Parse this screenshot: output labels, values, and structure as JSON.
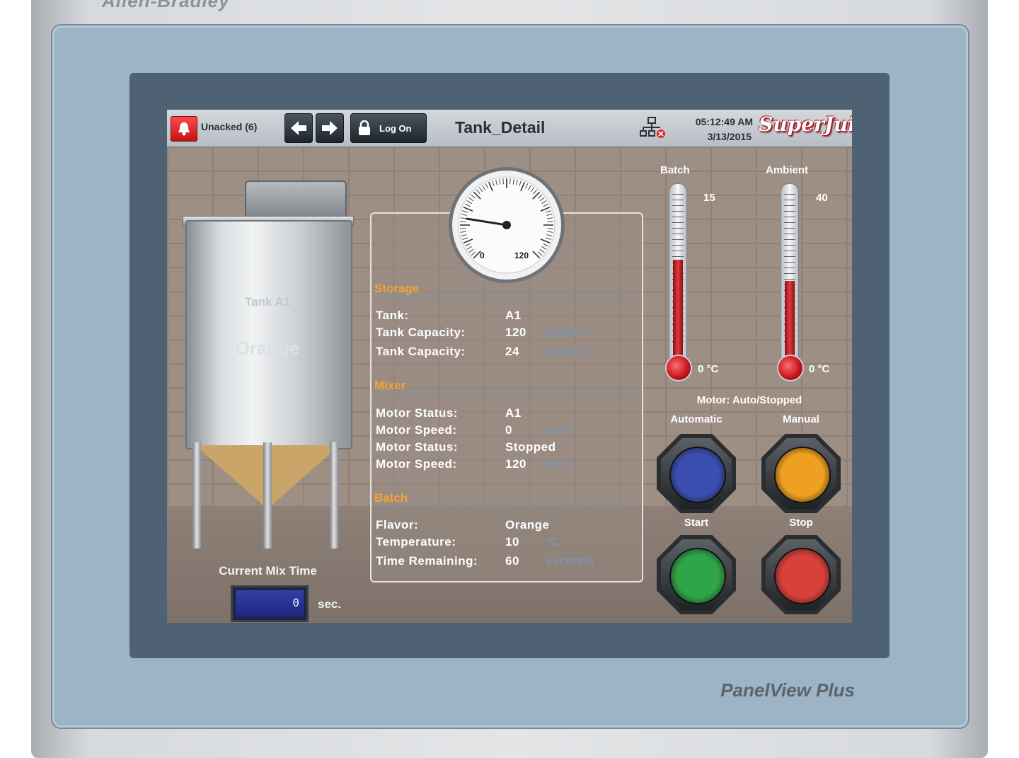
{
  "device": {
    "brand": "Allen-Bradley",
    "model": "PanelView Plus"
  },
  "header": {
    "alarm_label": "Unacked (6)",
    "logon_label": "Log On",
    "screen_title": "Tank_Detail",
    "time": "05:12:49 AM",
    "date": "3/13/2015",
    "logo_text": "SuperJuice"
  },
  "tank": {
    "name": "Tank A1",
    "flavor": "Orange",
    "mix_time_label": "Current Mix Time",
    "mix_time_value": "0",
    "mix_time_unit": "sec."
  },
  "gauge": {
    "min_label": "0",
    "max_label": "120",
    "value": 24
  },
  "storage": {
    "heading": "Storage",
    "rows": [
      {
        "label": "Tank:",
        "value": "A1",
        "unit": ""
      },
      {
        "label": "Tank Capacity:",
        "value": "120",
        "unit": "gallons"
      },
      {
        "label": "Tank Capacity:",
        "value": "24",
        "unit": "gallons"
      }
    ]
  },
  "mixer": {
    "heading": "Mixer",
    "rows": [
      {
        "label": "Motor Status:",
        "value": "A1",
        "unit": ""
      },
      {
        "label": "Motor Speed:",
        "value": "0",
        "unit": "rpm"
      },
      {
        "label": "Motor Status:",
        "value": "Stopped",
        "unit": ""
      },
      {
        "label": "Motor Speed:",
        "value": "120",
        "unit": "rpm"
      }
    ]
  },
  "batch": {
    "heading": "Batch",
    "rows": [
      {
        "label": "Flavor:",
        "value": "Orange",
        "unit": ""
      },
      {
        "label": "Temperature:",
        "value": "10",
        "unit": "°C"
      },
      {
        "label": "Time Remaining:",
        "value": "60",
        "unit": "seconds"
      }
    ]
  },
  "thermometers": {
    "batch": {
      "label": "Batch",
      "max": "15",
      "min": "0 °C",
      "fill_fraction": 0.62
    },
    "ambient": {
      "label": "Ambient",
      "max": "40",
      "min": "0 °C",
      "fill_fraction": 0.5
    }
  },
  "controls": {
    "motor_status": "Motor: Auto/Stopped",
    "automatic_label": "Automatic",
    "manual_label": "Manual",
    "start_label": "Start",
    "stop_label": "Stop",
    "colors": {
      "automatic": "#3a4fb0",
      "manual": "#f0a020",
      "start": "#2fa54a",
      "stop": "#d8403a"
    }
  }
}
